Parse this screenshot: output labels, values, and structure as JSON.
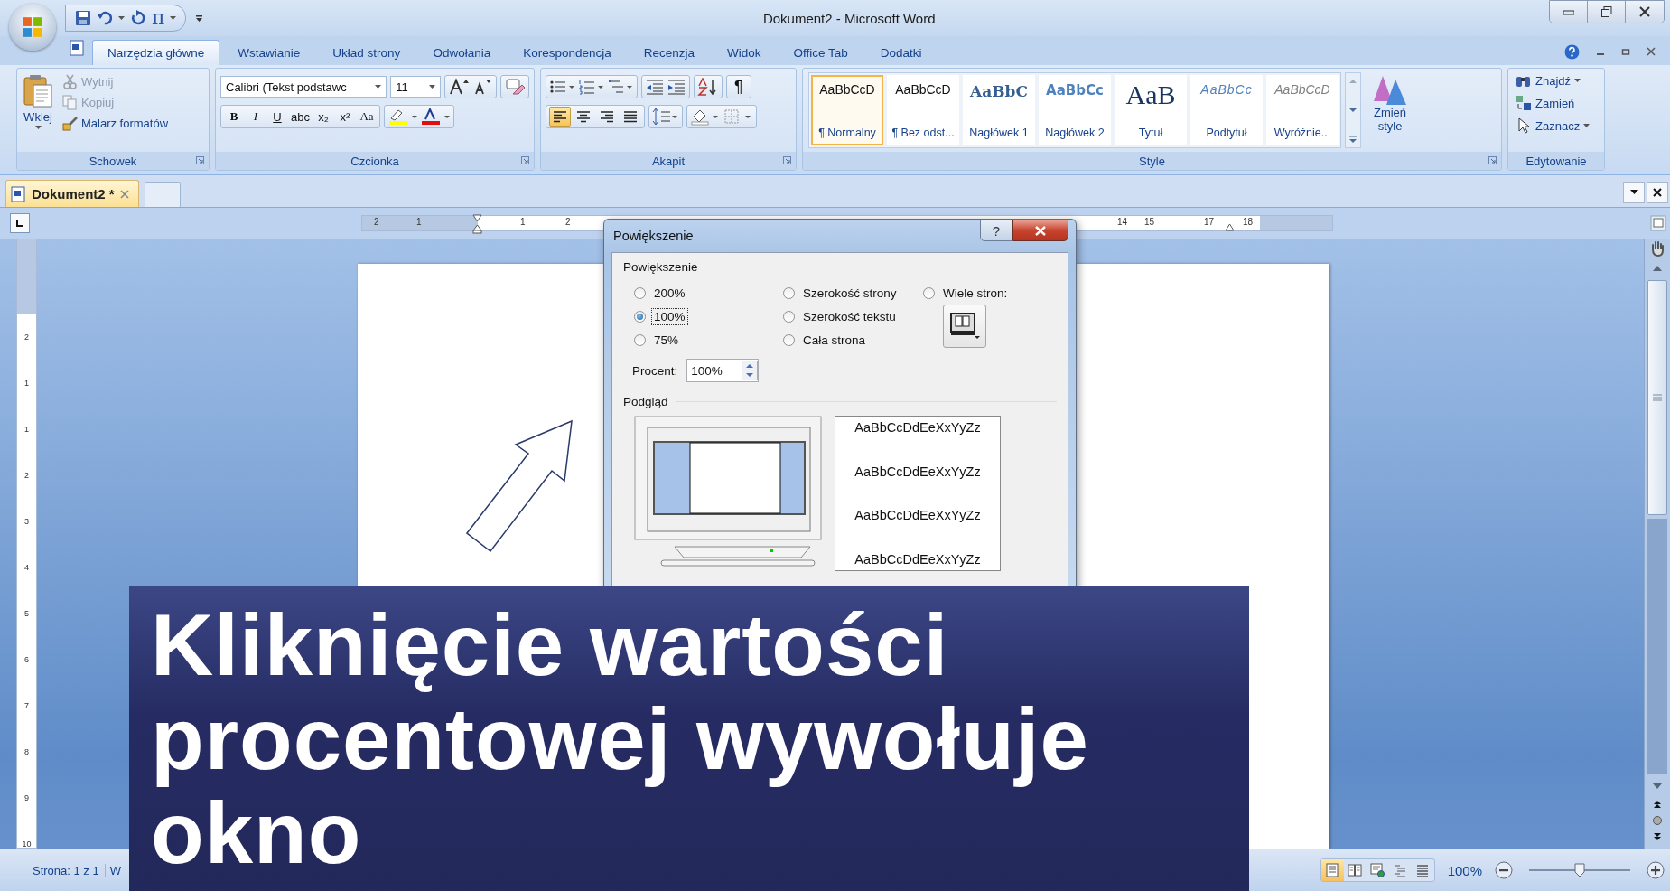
{
  "window": {
    "title": "Dokument2 - Microsoft Word"
  },
  "quick_access": {
    "equation": "π"
  },
  "ribbon_tabs": [
    {
      "label": "Narzędzia główne",
      "selected": true
    },
    {
      "label": "Wstawianie",
      "selected": false
    },
    {
      "label": "Układ strony",
      "selected": false
    },
    {
      "label": "Odwołania",
      "selected": false
    },
    {
      "label": "Korespondencja",
      "selected": false
    },
    {
      "label": "Recenzja",
      "selected": false
    },
    {
      "label": "Widok",
      "selected": false
    },
    {
      "label": "Office Tab",
      "selected": false
    },
    {
      "label": "Dodatki",
      "selected": false
    }
  ],
  "clipboard": {
    "group": "Schowek",
    "paste": "Wklej",
    "items": [
      {
        "kind": "cut",
        "label": "Wytnij",
        "disabled": true
      },
      {
        "kind": "copy",
        "label": "Kopiuj",
        "disabled": true
      },
      {
        "kind": "painter",
        "label": "Malarz formatów",
        "disabled": false
      }
    ]
  },
  "font": {
    "group": "Czcionka",
    "name": "Calibri (Tekst podstawc",
    "size": "11",
    "format_buttons": [
      {
        "kind": "bold",
        "label": "B"
      },
      {
        "kind": "italic",
        "label": "I"
      },
      {
        "kind": "underline",
        "label": "U"
      },
      {
        "kind": "strike",
        "label": "abc"
      },
      {
        "kind": "sub",
        "label": "x₂"
      },
      {
        "kind": "sup",
        "label": "x²"
      },
      {
        "kind": "case",
        "label": "Aa"
      }
    ]
  },
  "paragraph": {
    "group": "Akapit",
    "pilcrow": "¶",
    "alignments": [
      {
        "kind": "left",
        "selected": true
      },
      {
        "kind": "center",
        "selected": false
      },
      {
        "kind": "right",
        "selected": false
      },
      {
        "kind": "justify",
        "selected": false
      }
    ]
  },
  "styles": {
    "group": "Style",
    "change_styles": "Zmień style",
    "items": [
      {
        "kind": "normal",
        "sample": "AaBbCcD",
        "label": "¶ Normalny",
        "selected": true
      },
      {
        "kind": "normal",
        "sample": "AaBbCcD",
        "label": "¶ Bez odst...",
        "selected": false
      },
      {
        "kind": "heading1",
        "sample": "AaBbC",
        "label": "Nagłówek 1",
        "selected": false
      },
      {
        "kind": "heading2",
        "sample": "AaBbCc",
        "label": "Nagłówek 2",
        "selected": false
      },
      {
        "kind": "title",
        "sample": "AaB",
        "label": "Tytuł",
        "selected": false
      },
      {
        "kind": "subtitle",
        "sample": "AaBbCc",
        "label": "Podtytuł",
        "selected": false
      },
      {
        "kind": "emphasis",
        "sample": "AaBbCcD",
        "label": "Wyróżnie...",
        "selected": false
      }
    ]
  },
  "editing": {
    "group": "Edytowanie",
    "items": [
      {
        "kind": "find",
        "label": "Znajdź",
        "dropdown": true
      },
      {
        "kind": "replace",
        "label": "Zamień",
        "dropdown": false
      },
      {
        "kind": "select",
        "label": "Zaznacz",
        "dropdown": true
      }
    ]
  },
  "document_tabs": [
    {
      "label": "Dokument2 *",
      "selected": true
    }
  ],
  "ruler": {
    "left_numbers": [
      "2",
      "1",
      "1",
      "2"
    ],
    "right_numbers": [
      "14",
      "15",
      "17",
      "18"
    ]
  },
  "vertical_ruler": [
    "2",
    "1",
    "1",
    "2",
    "3",
    "4",
    "5",
    "6",
    "7",
    "8",
    "9",
    "10"
  ],
  "zoom_dialog": {
    "title": "Powiększenie",
    "help": "?",
    "section": "Powiększenie",
    "options": [
      {
        "label": "200%",
        "selected": false
      },
      {
        "label": "100%",
        "selected": true
      },
      {
        "label": "75%",
        "selected": false
      },
      {
        "label": "Szerokość strony",
        "selected": false
      },
      {
        "label": "Szerokość tekstu",
        "selected": false
      },
      {
        "label": "Cała strona",
        "selected": false
      },
      {
        "label": "Wiele stron:",
        "selected": false
      }
    ],
    "percent_label": "Procent:",
    "percent_value": "100%",
    "preview_section": "Podgląd",
    "preview_samples": [
      "AaBbCcDdEeXxYyZz",
      "AaBbCcDdEeXxYyZz",
      "AaBbCcDdEeXxYyZz",
      "AaBbCcDdEeXxYyZz"
    ]
  },
  "status_bar": {
    "page": "Strona: 1 z 1",
    "word_count": "W",
    "view_buttons": [
      {
        "kind": "print",
        "selected": true
      },
      {
        "kind": "reading",
        "selected": false
      },
      {
        "kind": "web",
        "selected": false
      },
      {
        "kind": "outline",
        "selected": false
      },
      {
        "kind": "draft",
        "selected": false
      }
    ],
    "zoom": "100%",
    "zoom_slider": {
      "level": 0.5
    }
  },
  "caption": {
    "text": "Kliknięcie wartości procentowej wywołuje okno"
  }
}
